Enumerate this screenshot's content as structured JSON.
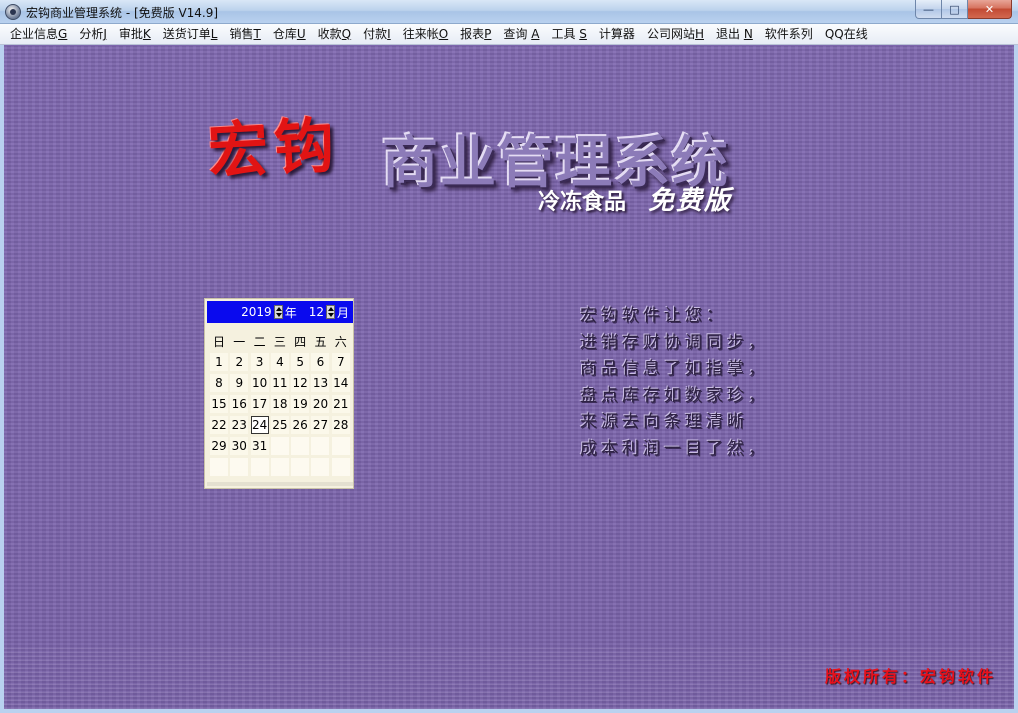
{
  "window": {
    "title": "宏钩商业管理系统 - [免费版 V14.9]",
    "minimize": "—",
    "maximize": "□",
    "close": "✕"
  },
  "menu": [
    {
      "text": "企业信息",
      "key": "G"
    },
    {
      "text": "分析",
      "key": "J"
    },
    {
      "text": "审批",
      "key": "K"
    },
    {
      "text": "送货订单",
      "key": "L"
    },
    {
      "text": "销售",
      "key": "T"
    },
    {
      "text": "仓库",
      "key": "U"
    },
    {
      "text": "收款",
      "key": "Q"
    },
    {
      "text": "付款",
      "key": "I"
    },
    {
      "text": "往来帐",
      "key": "O"
    },
    {
      "text": "报表",
      "key": "P"
    },
    {
      "text": "查询 ",
      "key": "A"
    },
    {
      "text": "工具 ",
      "key": "S"
    },
    {
      "text": "计算器",
      "key": ""
    },
    {
      "text": "公司网站",
      "key": "H"
    },
    {
      "text": "退出 ",
      "key": "N"
    },
    {
      "text": "软件系列",
      "key": ""
    },
    {
      "text": "QQ在线",
      "key": ""
    }
  ],
  "brand": {
    "name": "宏钩",
    "title": "商业管理系统",
    "edition_prefix": "冷冻食品",
    "edition_suffix": "免费版"
  },
  "calendar": {
    "year": "2019",
    "year_unit": "年",
    "month": "12",
    "month_unit": "月",
    "weekdays": [
      "日",
      "一",
      "二",
      "三",
      "四",
      "五",
      "六"
    ],
    "weeks": [
      [
        "1",
        "2",
        "3",
        "4",
        "5",
        "6",
        "7"
      ],
      [
        "8",
        "9",
        "10",
        "11",
        "12",
        "13",
        "14"
      ],
      [
        "15",
        "16",
        "17",
        "18",
        "19",
        "20",
        "21"
      ],
      [
        "22",
        "23",
        "24",
        "25",
        "26",
        "27",
        "28"
      ],
      [
        "29",
        "30",
        "31",
        "",
        "",
        "",
        ""
      ],
      [
        "",
        "",
        "",
        "",
        "",
        "",
        ""
      ]
    ],
    "today": "24"
  },
  "motto": {
    "heading": "宏钩软件让您：",
    "lines": [
      "进销存财协调同步，",
      "商品信息了如指掌，",
      "盘点库存如数家珍，",
      "来源去向条理清晰",
      "成本利润一目了然，"
    ]
  },
  "copyright": "版权所有：宏钩软件",
  "colors": {
    "background": "#7d66ad",
    "calendar_header": "#0a0aee",
    "brand_red": "#e11414",
    "copyright_red": "#e8101a"
  }
}
